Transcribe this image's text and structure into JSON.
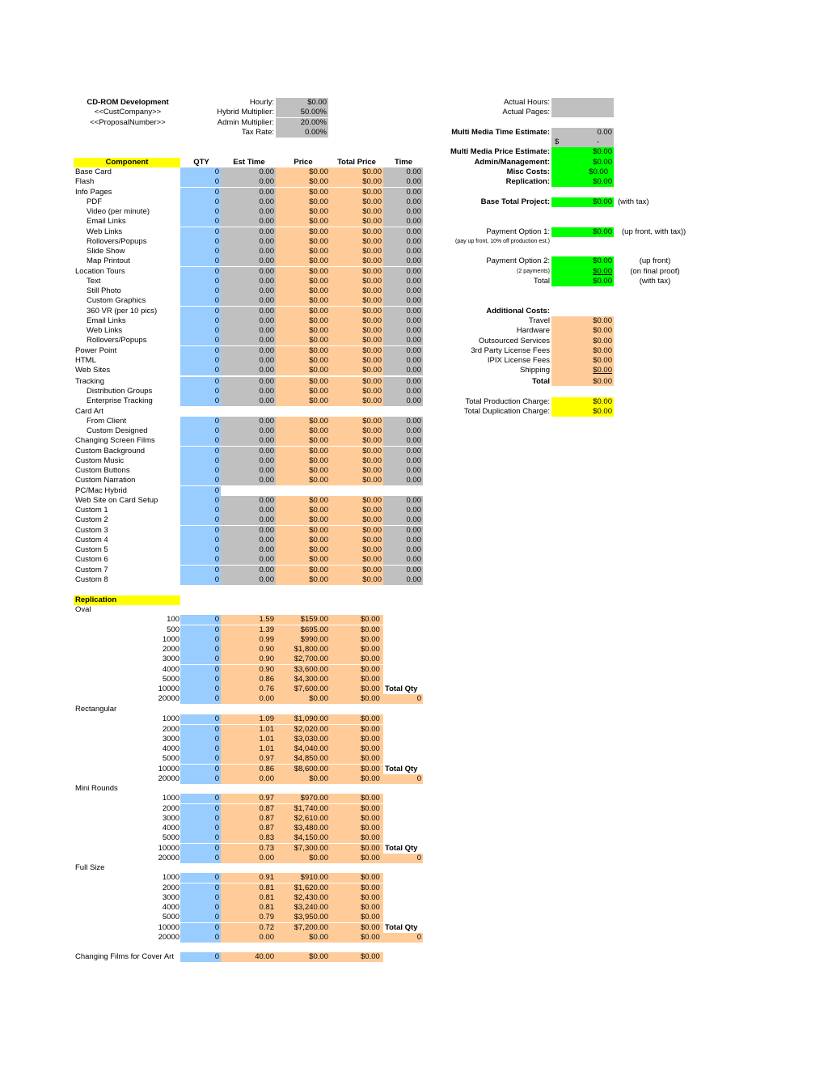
{
  "header": {
    "title": "CD-ROM Development",
    "company": "<<CustCompany>>",
    "proposal": "<<ProposalNumber>>",
    "params": [
      {
        "label": "Hourly:",
        "value": "$0.00"
      },
      {
        "label": "Hybrid Multiplier:",
        "value": "50.00%"
      },
      {
        "label": "Admin Multiplier:",
        "value": "20.00%"
      },
      {
        "label": "Tax Rate:",
        "value": "0.00%"
      }
    ]
  },
  "columns": {
    "component": "Component",
    "qty": "QTY",
    "est_time": "Est Time",
    "price": "Price",
    "total_price": "Total Price",
    "time": "Time"
  },
  "components": [
    {
      "name": "Base Card",
      "indent": 0,
      "qty": "0",
      "est": "0.00",
      "price": "$0.00",
      "total": "$0.00",
      "time": "0.00"
    },
    {
      "name": "Flash",
      "indent": 0,
      "qty": "0",
      "est": "0.00",
      "price": "$0.00",
      "total": "$0.00",
      "time": "0.00"
    },
    {
      "name": "Info Pages",
      "indent": 0,
      "qty": "0",
      "est": "0.00",
      "price": "$0.00",
      "total": "$0.00",
      "time": "0.00"
    },
    {
      "name": "PDF",
      "indent": 1,
      "qty": "0",
      "est": "0.00",
      "price": "$0.00",
      "total": "$0.00",
      "time": "0.00"
    },
    {
      "name": "Video (per minute)",
      "indent": 1,
      "qty": "0",
      "est": "0.00",
      "price": "$0.00",
      "total": "$0.00",
      "time": "0.00"
    },
    {
      "name": "Email Links",
      "indent": 1,
      "qty": "0",
      "est": "0.00",
      "price": "$0.00",
      "total": "$0.00",
      "time": "0.00"
    },
    {
      "name": "Web Links",
      "indent": 1,
      "qty": "0",
      "est": "0.00",
      "price": "$0.00",
      "total": "$0.00",
      "time": "0.00"
    },
    {
      "name": "Rollovers/Popups",
      "indent": 1,
      "qty": "0",
      "est": "0.00",
      "price": "$0.00",
      "total": "$0.00",
      "time": "0.00"
    },
    {
      "name": "Slide Show",
      "indent": 1,
      "qty": "0",
      "est": "0.00",
      "price": "$0.00",
      "total": "$0.00",
      "time": "0.00"
    },
    {
      "name": "Map Printout",
      "indent": 1,
      "qty": "0",
      "est": "0.00",
      "price": "$0.00",
      "total": "$0.00",
      "time": "0.00"
    },
    {
      "name": "Location Tours",
      "indent": 0,
      "qty": "0",
      "est": "0.00",
      "price": "$0.00",
      "total": "$0.00",
      "time": "0.00"
    },
    {
      "name": "Text",
      "indent": 1,
      "qty": "0",
      "est": "0.00",
      "price": "$0.00",
      "total": "$0.00",
      "time": "0.00"
    },
    {
      "name": "Still Photo",
      "indent": 1,
      "qty": "0",
      "est": "0.00",
      "price": "$0.00",
      "total": "$0.00",
      "time": "0.00"
    },
    {
      "name": "Custom Graphics",
      "indent": 1,
      "qty": "0",
      "est": "0.00",
      "price": "$0.00",
      "total": "$0.00",
      "time": "0.00"
    },
    {
      "name": "360 VR (per 10 pics)",
      "indent": 1,
      "qty": "0",
      "est": "0.00",
      "price": "$0.00",
      "total": "$0.00",
      "time": "0.00"
    },
    {
      "name": "Email Links",
      "indent": 1,
      "qty": "0",
      "est": "0.00",
      "price": "$0.00",
      "total": "$0.00",
      "time": "0.00"
    },
    {
      "name": "Web Links",
      "indent": 1,
      "qty": "0",
      "est": "0.00",
      "price": "$0.00",
      "total": "$0.00",
      "time": "0.00"
    },
    {
      "name": "Rollovers/Popups",
      "indent": 1,
      "qty": "0",
      "est": "0.00",
      "price": "$0.00",
      "total": "$0.00",
      "time": "0.00"
    },
    {
      "name": "Power Point",
      "indent": 0,
      "qty": "0",
      "est": "0.00",
      "price": "$0.00",
      "total": "$0.00",
      "time": "0.00"
    },
    {
      "name": "HTML",
      "indent": 0,
      "qty": "0",
      "est": "0.00",
      "price": "$0.00",
      "total": "$0.00",
      "time": "0.00"
    },
    {
      "name": "Web Sites",
      "indent": 0,
      "qty": "0",
      "est": "0.00",
      "price": "$0.00",
      "total": "$0.00",
      "time": "0.00"
    },
    {
      "name": "Tracking",
      "indent": 0,
      "qty": "0",
      "est": "0.00",
      "price": "$0.00",
      "total": "$0.00",
      "time": "0.00",
      "gap_before": true
    },
    {
      "name": "Distribution Groups",
      "indent": 1,
      "qty": "0",
      "est": "0.00",
      "price": "$0.00",
      "total": "$0.00",
      "time": "0.00"
    },
    {
      "name": "Enterprise Tracking",
      "indent": 1,
      "qty": "0",
      "est": "0.00",
      "price": "$0.00",
      "total": "$0.00",
      "time": "0.00"
    },
    {
      "name": "Card Art",
      "indent": 0,
      "label_only": true
    },
    {
      "name": "From Client",
      "indent": 1,
      "qty": "0",
      "est": "0.00",
      "price": "$0.00",
      "total": "$0.00",
      "time": "0.00"
    },
    {
      "name": "Custom Designed",
      "indent": 1,
      "qty": "0",
      "est": "0.00",
      "price": "$0.00",
      "total": "$0.00",
      "time": "0.00"
    },
    {
      "name": "Changing Screen Films",
      "indent": 0,
      "qty": "0",
      "est": "0.00",
      "price": "$0.00",
      "total": "$0.00",
      "time": "0.00"
    },
    {
      "name": "Custom Background",
      "indent": 0,
      "qty": "0",
      "est": "0.00",
      "price": "$0.00",
      "total": "$0.00",
      "time": "0.00"
    },
    {
      "name": "Custom Music",
      "indent": 0,
      "qty": "0",
      "est": "0.00",
      "price": "$0.00",
      "total": "$0.00",
      "time": "0.00"
    },
    {
      "name": "Custom Buttons",
      "indent": 0,
      "qty": "0",
      "est": "0.00",
      "price": "$0.00",
      "total": "$0.00",
      "time": "0.00"
    },
    {
      "name": "Custom Narration",
      "indent": 0,
      "qty": "0",
      "est": "0.00",
      "price": "$0.00",
      "total": "$0.00",
      "time": "0.00"
    },
    {
      "name": "PC/Mac Hybrid",
      "indent": 0,
      "qty": "0",
      "qty_only": true
    },
    {
      "name": "Web Site on Card Setup",
      "indent": 0,
      "qty": "0",
      "est": "0.00",
      "price": "$0.00",
      "total": "$0.00",
      "time": "0.00"
    },
    {
      "name": "Custom 1",
      "indent": 0,
      "qty": "0",
      "est": "0.00",
      "price": "$0.00",
      "total": "$0.00",
      "time": "0.00"
    },
    {
      "name": "Custom 2",
      "indent": 0,
      "qty": "0",
      "est": "0.00",
      "price": "$0.00",
      "total": "$0.00",
      "time": "0.00"
    },
    {
      "name": "Custom 3",
      "indent": 0,
      "qty": "0",
      "est": "0.00",
      "price": "$0.00",
      "total": "$0.00",
      "time": "0.00"
    },
    {
      "name": "Custom 4",
      "indent": 0,
      "qty": "0",
      "est": "0.00",
      "price": "$0.00",
      "total": "$0.00",
      "time": "0.00"
    },
    {
      "name": "Custom 5",
      "indent": 0,
      "qty": "0",
      "est": "0.00",
      "price": "$0.00",
      "total": "$0.00",
      "time": "0.00"
    },
    {
      "name": "Custom 6",
      "indent": 0,
      "qty": "0",
      "est": "0.00",
      "price": "$0.00",
      "total": "$0.00",
      "time": "0.00"
    },
    {
      "name": "Custom 7",
      "indent": 0,
      "qty": "0",
      "est": "0.00",
      "price": "$0.00",
      "total": "$0.00",
      "time": "0.00"
    },
    {
      "name": "Custom 8",
      "indent": 0,
      "qty": "0",
      "est": "0.00",
      "price": "$0.00",
      "total": "$0.00",
      "time": "0.00"
    }
  ],
  "replication": {
    "title": "Replication",
    "total_qty_label": "Total Qty",
    "groups": [
      {
        "name": "Oval",
        "total_qty": "0",
        "rows": [
          {
            "qty_tier": "100",
            "qty": "0",
            "unit": "1.59",
            "price": "$159.00",
            "total": "$0.00"
          },
          {
            "qty_tier": "500",
            "qty": "0",
            "unit": "1.39",
            "price": "$695.00",
            "total": "$0.00"
          },
          {
            "qty_tier": "1000",
            "qty": "0",
            "unit": "0.99",
            "price": "$990.00",
            "total": "$0.00"
          },
          {
            "qty_tier": "2000",
            "qty": "0",
            "unit": "0.90",
            "price": "$1,800.00",
            "total": "$0.00"
          },
          {
            "qty_tier": "3000",
            "qty": "0",
            "unit": "0.90",
            "price": "$2,700.00",
            "total": "$0.00"
          },
          {
            "qty_tier": "4000",
            "qty": "0",
            "unit": "0.90",
            "price": "$3,600.00",
            "total": "$0.00"
          },
          {
            "qty_tier": "5000",
            "qty": "0",
            "unit": "0.86",
            "price": "$4,300.00",
            "total": "$0.00"
          },
          {
            "qty_tier": "10000",
            "qty": "0",
            "unit": "0.76",
            "price": "$7,600.00",
            "total": "$0.00"
          },
          {
            "qty_tier": "20000",
            "qty": "0",
            "unit": "0.00",
            "price": "$0.00",
            "total": "$0.00"
          }
        ]
      },
      {
        "name": "Rectangular",
        "total_qty": "0",
        "rows": [
          {
            "qty_tier": "1000",
            "qty": "0",
            "unit": "1.09",
            "price": "$1,090.00",
            "total": "$0.00"
          },
          {
            "qty_tier": "2000",
            "qty": "0",
            "unit": "1.01",
            "price": "$2,020.00",
            "total": "$0.00"
          },
          {
            "qty_tier": "3000",
            "qty": "0",
            "unit": "1.01",
            "price": "$3,030.00",
            "total": "$0.00"
          },
          {
            "qty_tier": "4000",
            "qty": "0",
            "unit": "1.01",
            "price": "$4,040.00",
            "total": "$0.00"
          },
          {
            "qty_tier": "5000",
            "qty": "0",
            "unit": "0.97",
            "price": "$4,850.00",
            "total": "$0.00"
          },
          {
            "qty_tier": "10000",
            "qty": "0",
            "unit": "0.86",
            "price": "$8,600.00",
            "total": "$0.00"
          },
          {
            "qty_tier": "20000",
            "qty": "0",
            "unit": "0.00",
            "price": "$0.00",
            "total": "$0.00"
          }
        ]
      },
      {
        "name": "Mini Rounds",
        "total_qty": "0",
        "rows": [
          {
            "qty_tier": "1000",
            "qty": "0",
            "unit": "0.97",
            "price": "$970.00",
            "total": "$0.00"
          },
          {
            "qty_tier": "2000",
            "qty": "0",
            "unit": "0.87",
            "price": "$1,740.00",
            "total": "$0.00"
          },
          {
            "qty_tier": "3000",
            "qty": "0",
            "unit": "0.87",
            "price": "$2,610.00",
            "total": "$0.00"
          },
          {
            "qty_tier": "4000",
            "qty": "0",
            "unit": "0.87",
            "price": "$3,480.00",
            "total": "$0.00"
          },
          {
            "qty_tier": "5000",
            "qty": "0",
            "unit": "0.83",
            "price": "$4,150.00",
            "total": "$0.00"
          },
          {
            "qty_tier": "10000",
            "qty": "0",
            "unit": "0.73",
            "price": "$7,300.00",
            "total": "$0.00"
          },
          {
            "qty_tier": "20000",
            "qty": "0",
            "unit": "0.00",
            "price": "$0.00",
            "total": "$0.00"
          }
        ]
      },
      {
        "name": "Full Size",
        "total_qty": "0",
        "rows": [
          {
            "qty_tier": "1000",
            "qty": "0",
            "unit": "0.91",
            "price": "$910.00",
            "total": "$0.00"
          },
          {
            "qty_tier": "2000",
            "qty": "0",
            "unit": "0.81",
            "price": "$1,620.00",
            "total": "$0.00"
          },
          {
            "qty_tier": "3000",
            "qty": "0",
            "unit": "0.81",
            "price": "$2,430.00",
            "total": "$0.00"
          },
          {
            "qty_tier": "4000",
            "qty": "0",
            "unit": "0.81",
            "price": "$3,240.00",
            "total": "$0.00"
          },
          {
            "qty_tier": "5000",
            "qty": "0",
            "unit": "0.79",
            "price": "$3,950.00",
            "total": "$0.00"
          },
          {
            "qty_tier": "10000",
            "qty": "0",
            "unit": "0.72",
            "price": "$7,200.00",
            "total": "$0.00"
          },
          {
            "qty_tier": "20000",
            "qty": "0",
            "unit": "0.00",
            "price": "$0.00",
            "total": "$0.00"
          }
        ]
      }
    ],
    "cover_art": {
      "label": "Changing Films for Cover Art",
      "qty": "0",
      "unit": "40.00",
      "price": "$0.00",
      "total": "$0.00"
    }
  },
  "summary": {
    "actual_hours_label": "Actual Hours:",
    "actual_hours": "",
    "actual_pages_label": "Actual Pages:",
    "actual_pages": "",
    "time_estimate_label": "Multi Media Time Estimate:",
    "time_estimate": "0.00",
    "time_estimate_dollar": "$",
    "time_estimate_dash": "-",
    "price_estimate_label": "Multi Media Price Estimate:",
    "price_estimate": "$0.00",
    "admin_label": "Admin/Management:",
    "admin": "$0.00",
    "misc_label": "Misc Costs:",
    "misc": "$0.00",
    "replication_label": "Replication:",
    "replication": "$0.00",
    "base_total_label": "Base Total Project:",
    "base_total": "$0.00",
    "base_total_note": "(with tax)",
    "payment1_label": "Payment Option 1:",
    "payment1": "$0.00",
    "payment1_note": "(up front, with tax))",
    "payment1_sub": "(pay up front, 10% off production est.)",
    "payment2_label": "Payment Option 2:",
    "payment2_a": "$0.00",
    "payment2_a_note": "(up front)",
    "payment2_sub": "(2 payments)",
    "payment2_b": "$0.00",
    "payment2_b_note": "(on final proof)",
    "payment2_total_label": "Total",
    "payment2_total": "$0.00",
    "payment2_total_note": "(with tax)"
  },
  "additional_costs": {
    "title": "Additional Costs:",
    "items": [
      {
        "label": "Travel",
        "value": "$0.00"
      },
      {
        "label": "Hardware",
        "value": "$0.00"
      },
      {
        "label": "Outsourced Services",
        "value": "$0.00"
      },
      {
        "label": "3rd Party License Fees",
        "value": "$0.00"
      },
      {
        "label": "IPIX License Fees",
        "value": "$0.00"
      },
      {
        "label": "Shipping",
        "value": "$0.00"
      }
    ],
    "total_label": "Total",
    "total": "$0.00",
    "production_label": "Total Production Charge:",
    "production": "$0.00",
    "duplication_label": "Total Duplication Charge:",
    "duplication": "$0.00"
  },
  "colors": {
    "input_blue": "#99ccff",
    "calc_gray": "#c0c0c0",
    "price_peach": "#ffcc99",
    "summary_green": "#00ff00",
    "highlight_yellow": "#ffff00"
  }
}
